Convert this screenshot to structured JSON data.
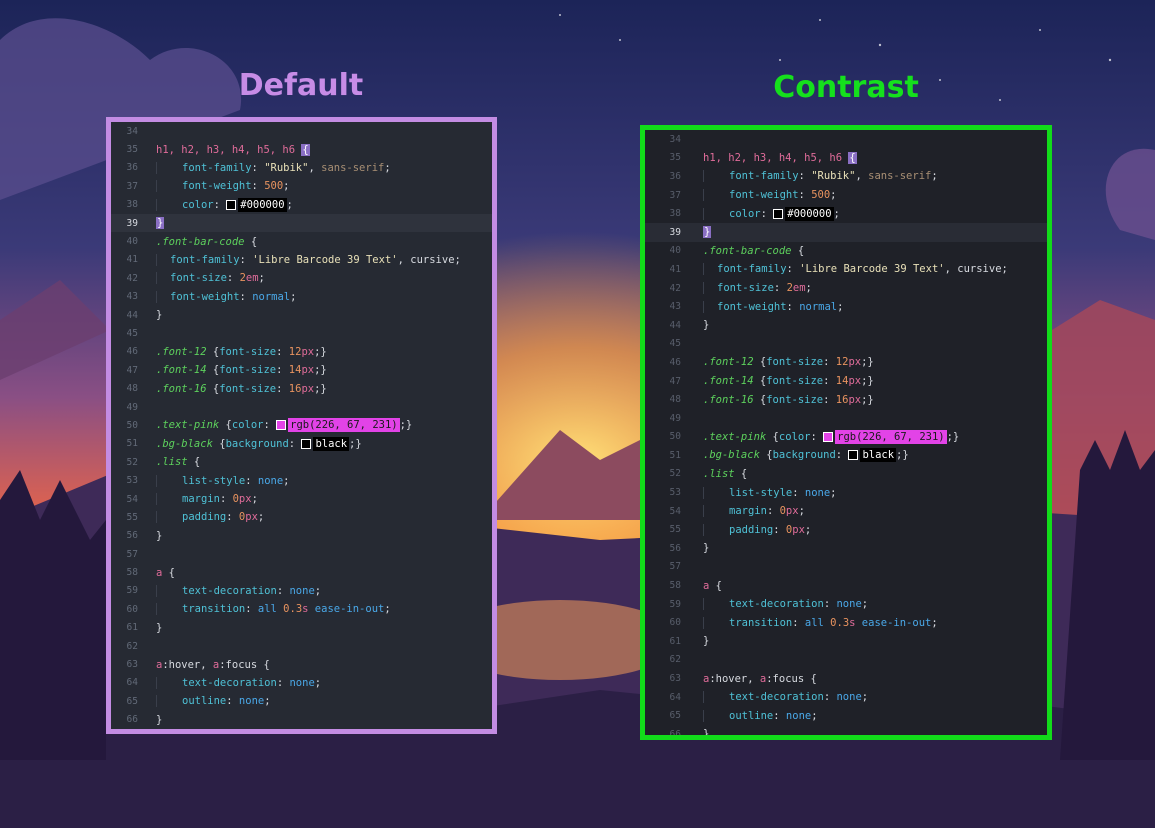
{
  "titles": {
    "default": "Default",
    "contrast": "Contrast"
  },
  "colors": {
    "default_frame": "#c38ce3",
    "contrast_frame": "#12db1a"
  },
  "code": {
    "line_numbers": [
      "34",
      "35",
      "36",
      "37",
      "38",
      "39",
      "40",
      "41",
      "42",
      "43",
      "44",
      "45",
      "46",
      "47",
      "48",
      "49",
      "50",
      "51",
      "52",
      "53",
      "54",
      "55",
      "56",
      "57",
      "58",
      "59",
      "60",
      "61",
      "62",
      "63",
      "64",
      "65",
      "66"
    ],
    "l35_sel": "h1, h2, h3, h4, h5, h6 ",
    "l35_brace": "{",
    "l36_prop": "font-family",
    "l36_str": "\"Rubik\"",
    "l36_mute": "sans-serif",
    "l37_prop": "font-weight",
    "l37_num": "500",
    "l38_prop": "color",
    "l38_val": "#000000",
    "l39_brace": "}",
    "l40_cls": ".font-bar-code",
    "l41_prop": "font-family",
    "l41_str": "'Libre Barcode 39 Text'",
    "l41_val": "cursive",
    "l42_prop": "font-size",
    "l42_num": "2",
    "l42_unit": "em",
    "l43_prop": "font-weight",
    "l43_val": "normal",
    "l46_cls": ".font-12",
    "l46_prop": "font-size",
    "l46_num": "12",
    "l47_cls": ".font-14",
    "l47_prop": "font-size",
    "l47_num": "14",
    "l48_cls": ".font-16",
    "l48_prop": "font-size",
    "l48_num": "16",
    "unit_px": "px",
    "l50_cls": ".text-pink",
    "l50_prop": "color",
    "l50_val": "rgb(226, 67, 231)",
    "l51_cls": ".bg-black",
    "l51_prop": "background",
    "l51_val": "black",
    "l52_cls": ".list",
    "l53_prop": "list-style",
    "l53_val": "none",
    "l54_prop": "margin",
    "l54_num": "0",
    "l55_prop": "padding",
    "l55_num": "0",
    "l58_sel": "a",
    "l59_prop": "text-decoration",
    "l59_val": "none",
    "l60_prop": "transition",
    "l60_val1": "all",
    "l60_num": "0.3",
    "l60_unit": "s",
    "l60_val2": "ease-in-out",
    "l63_sel1": "a",
    "l63_mid1": ":hover, ",
    "l63_sel2": "a",
    "l63_mid2": ":focus",
    "l64_prop": "text-decoration",
    "l64_val": "none",
    "l65_prop": "outline",
    "l65_val": "none"
  }
}
